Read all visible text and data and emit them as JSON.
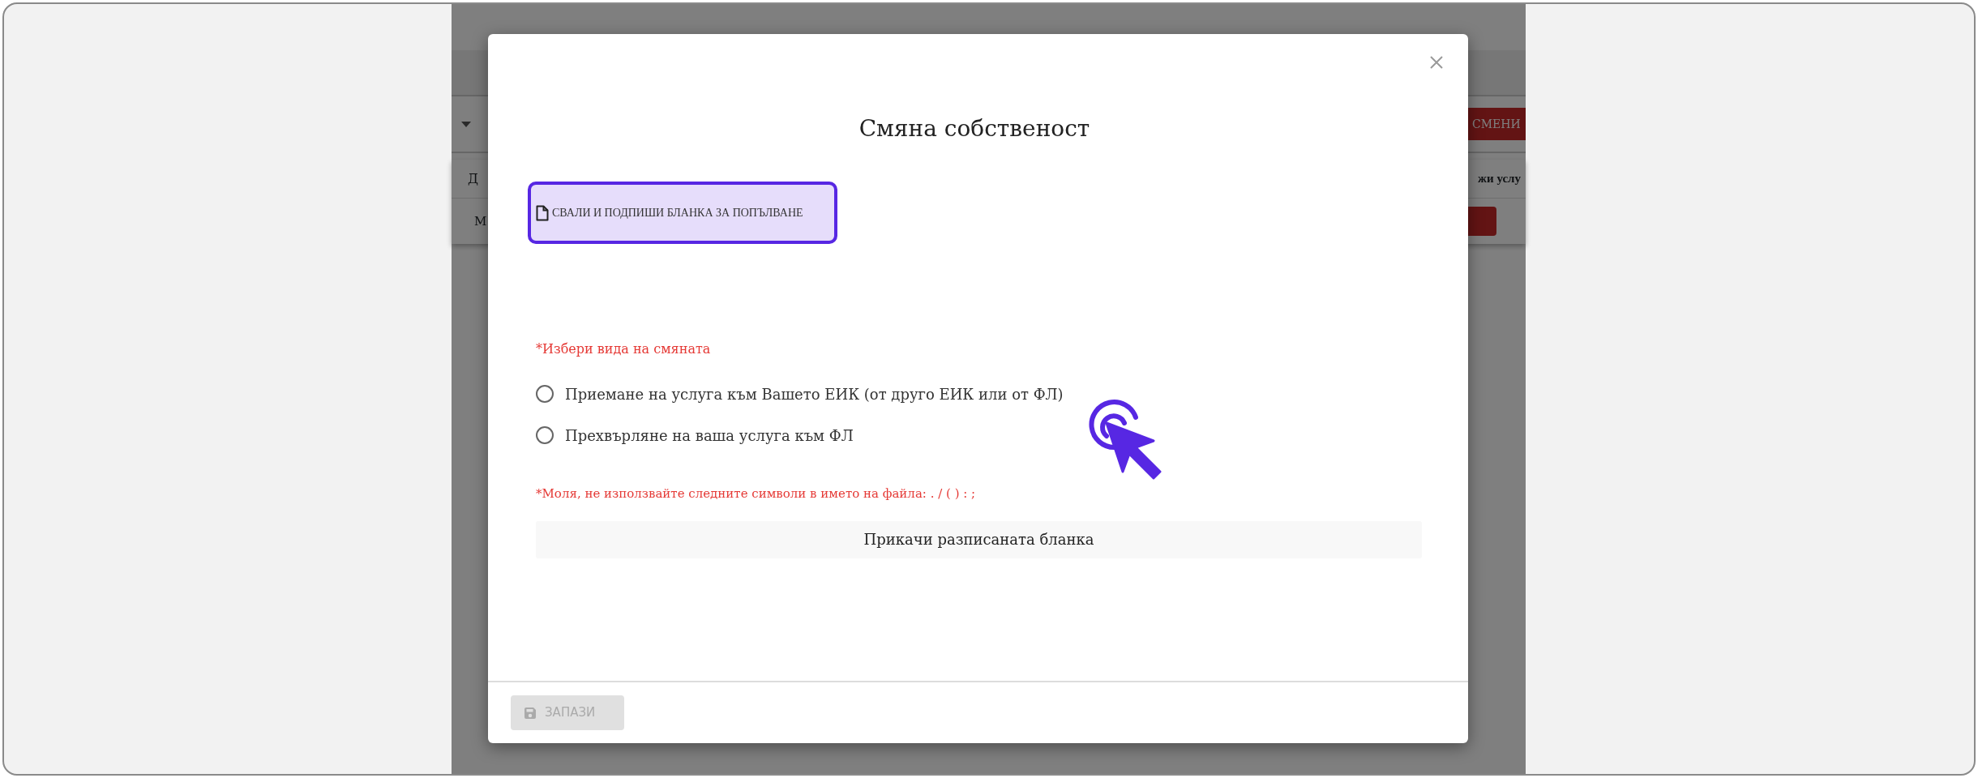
{
  "background_page": {
    "header_cell_left": "Д",
    "header_cell_right": "жи услу",
    "row_cell_left": "М",
    "change_button": "СМЕНИ"
  },
  "dialog": {
    "title": "Смяна собственост",
    "download_button": "СВАЛИ И ПОДПИШИ БЛАНКА ЗА ПОПЪЛВАНЕ",
    "choice_label": "*Избери вида на смяната",
    "options": [
      {
        "label": "Приемане на услуга към Вашето ЕИК (от друго ЕИК или от ФЛ)",
        "selected": false
      },
      {
        "label": "Прехвърляне на ваша услуга към ФЛ",
        "selected": false
      }
    ],
    "note": "*Моля, не използвайте следните символи в името на файла: . / ( ) : ;",
    "attach_button": "Прикачи разписаната бланка",
    "save_button": {
      "label": "ЗАПАЗИ",
      "disabled": true
    }
  }
}
